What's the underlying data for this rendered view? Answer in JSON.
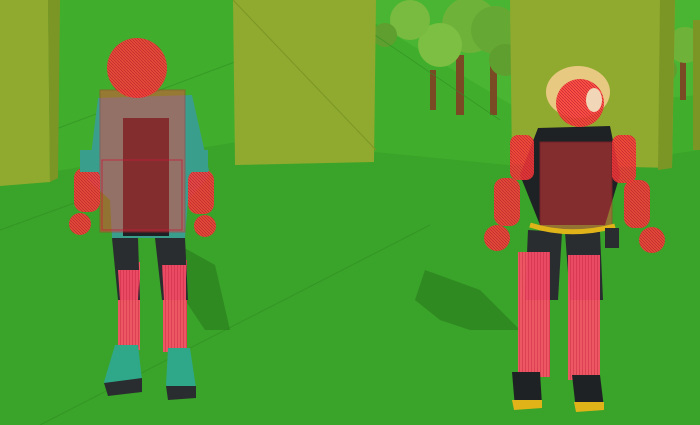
{
  "scene": {
    "type": "3d-game-viewport",
    "description_visible_text": "",
    "colors": {
      "ground": "#3fae2b",
      "ground_dark": "#2f8f22",
      "wall": "#8faa2e",
      "wall_dark": "#7c9626",
      "tree_leaves": "#6fb23a",
      "tree_trunk": "#7a4a25",
      "collider_red": "#ff3b3b",
      "collider_pink": "#ff4f6a",
      "shadow": "#2b7f1f"
    },
    "characters": [
      {
        "id": "character-left",
        "outfit": "teal-jacket-black-shirt",
        "collider_overlay": true
      },
      {
        "id": "character-right",
        "outfit": "black-top-yellow-belt-blonde-hair",
        "collider_overlay": true
      }
    ]
  }
}
